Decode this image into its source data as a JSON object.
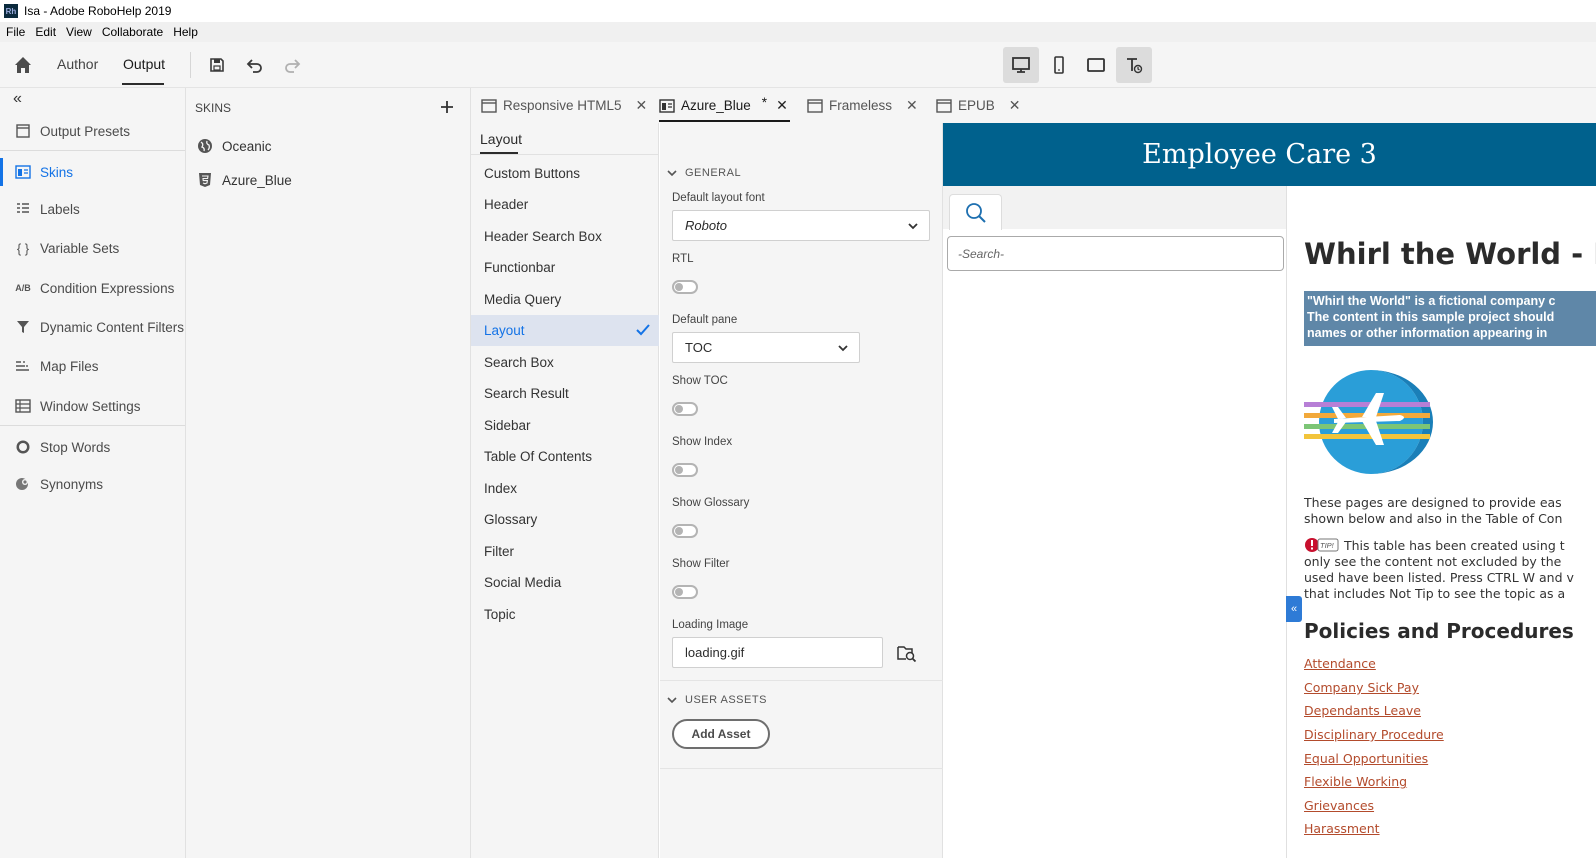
{
  "window": {
    "title": "Isa - Adobe RoboHelp 2019",
    "app_icon": "Rh"
  },
  "menu": [
    "File",
    "Edit",
    "View",
    "Collaborate",
    "Help"
  ],
  "toolbar": {
    "author_label": "Author",
    "output_label": "Output"
  },
  "leftnav": {
    "items": [
      {
        "label": "Output Presets",
        "icon": "output-presets-icon"
      },
      {
        "label": "Skins",
        "icon": "skins-icon",
        "active": true
      },
      {
        "label": "Labels",
        "icon": "labels-icon"
      },
      {
        "label": "Variable Sets",
        "icon": "braces-icon",
        "icon_text": "{ }"
      },
      {
        "label": "Condition Expressions",
        "icon": "ab-icon",
        "icon_text": "A/B"
      },
      {
        "label": "Dynamic Content Filters",
        "icon": "filter-icon"
      },
      {
        "label": "Map Files",
        "icon": "map-files-icon"
      },
      {
        "label": "Window Settings",
        "icon": "window-settings-icon"
      },
      {
        "label": "Stop Words",
        "icon": "stop-words-icon"
      },
      {
        "label": "Synonyms",
        "icon": "synonyms-icon"
      }
    ]
  },
  "skins": {
    "header": "SKINS",
    "items": [
      "Oceanic",
      "Azure_Blue"
    ]
  },
  "doc_tabs": [
    {
      "label": "Responsive HTML5"
    },
    {
      "label": "Azure_Blue",
      "modified": "*",
      "active": true
    },
    {
      "label": "Frameless"
    },
    {
      "label": "EPUB"
    }
  ],
  "layout_panel": {
    "tab": "Layout",
    "items": [
      "Custom Buttons",
      "Header",
      "Header Search Box",
      "Functionbar",
      "Media Query",
      "Layout",
      "Search Box",
      "Search Result",
      "Sidebar",
      "Table Of Contents",
      "Index",
      "Glossary",
      "Filter",
      "Social Media",
      "Topic"
    ],
    "active_index": 5
  },
  "props": {
    "general_header": "GENERAL",
    "default_font_label": "Default layout font",
    "default_font_value": "Roboto",
    "rtl_label": "RTL",
    "default_pane_label": "Default pane",
    "default_pane_value": "TOC",
    "show_toc_label": "Show TOC",
    "show_index_label": "Show Index",
    "show_glossary_label": "Show Glossary",
    "show_filter_label": "Show Filter",
    "loading_image_label": "Loading Image",
    "loading_image_value": "loading.gif",
    "user_assets_header": "USER ASSETS",
    "add_asset_label": "Add Asset"
  },
  "preview": {
    "banner": "Employee Care 3",
    "banner_color": "#00618d",
    "search_placeholder": "-Search-",
    "heading": "Whirl the World - En",
    "note_lines": [
      "\"Whirl the World\" is a fictional company c",
      "The content in this sample project should",
      "names or other information appearing in"
    ],
    "para1": [
      "These pages are designed to provide eas",
      "shown below and also in the Table of Con"
    ],
    "tip_lines": [
      "This table has been created using t",
      "only see the content not excluded by the",
      "used have been listed. Press CTRL W and v",
      "that includes Not Tip to see the topic as a"
    ],
    "tip_badge": "TIP!",
    "section_heading": "Policies and Procedures",
    "links": [
      "Attendance",
      "Company Sick Pay",
      "Dependants Leave",
      "Disciplinary Procedure",
      "Equal Opportunities",
      "Flexible Working",
      "Grievances",
      "Harassment"
    ],
    "collapse_glyph": "«"
  },
  "accent_color": "#1473e6"
}
